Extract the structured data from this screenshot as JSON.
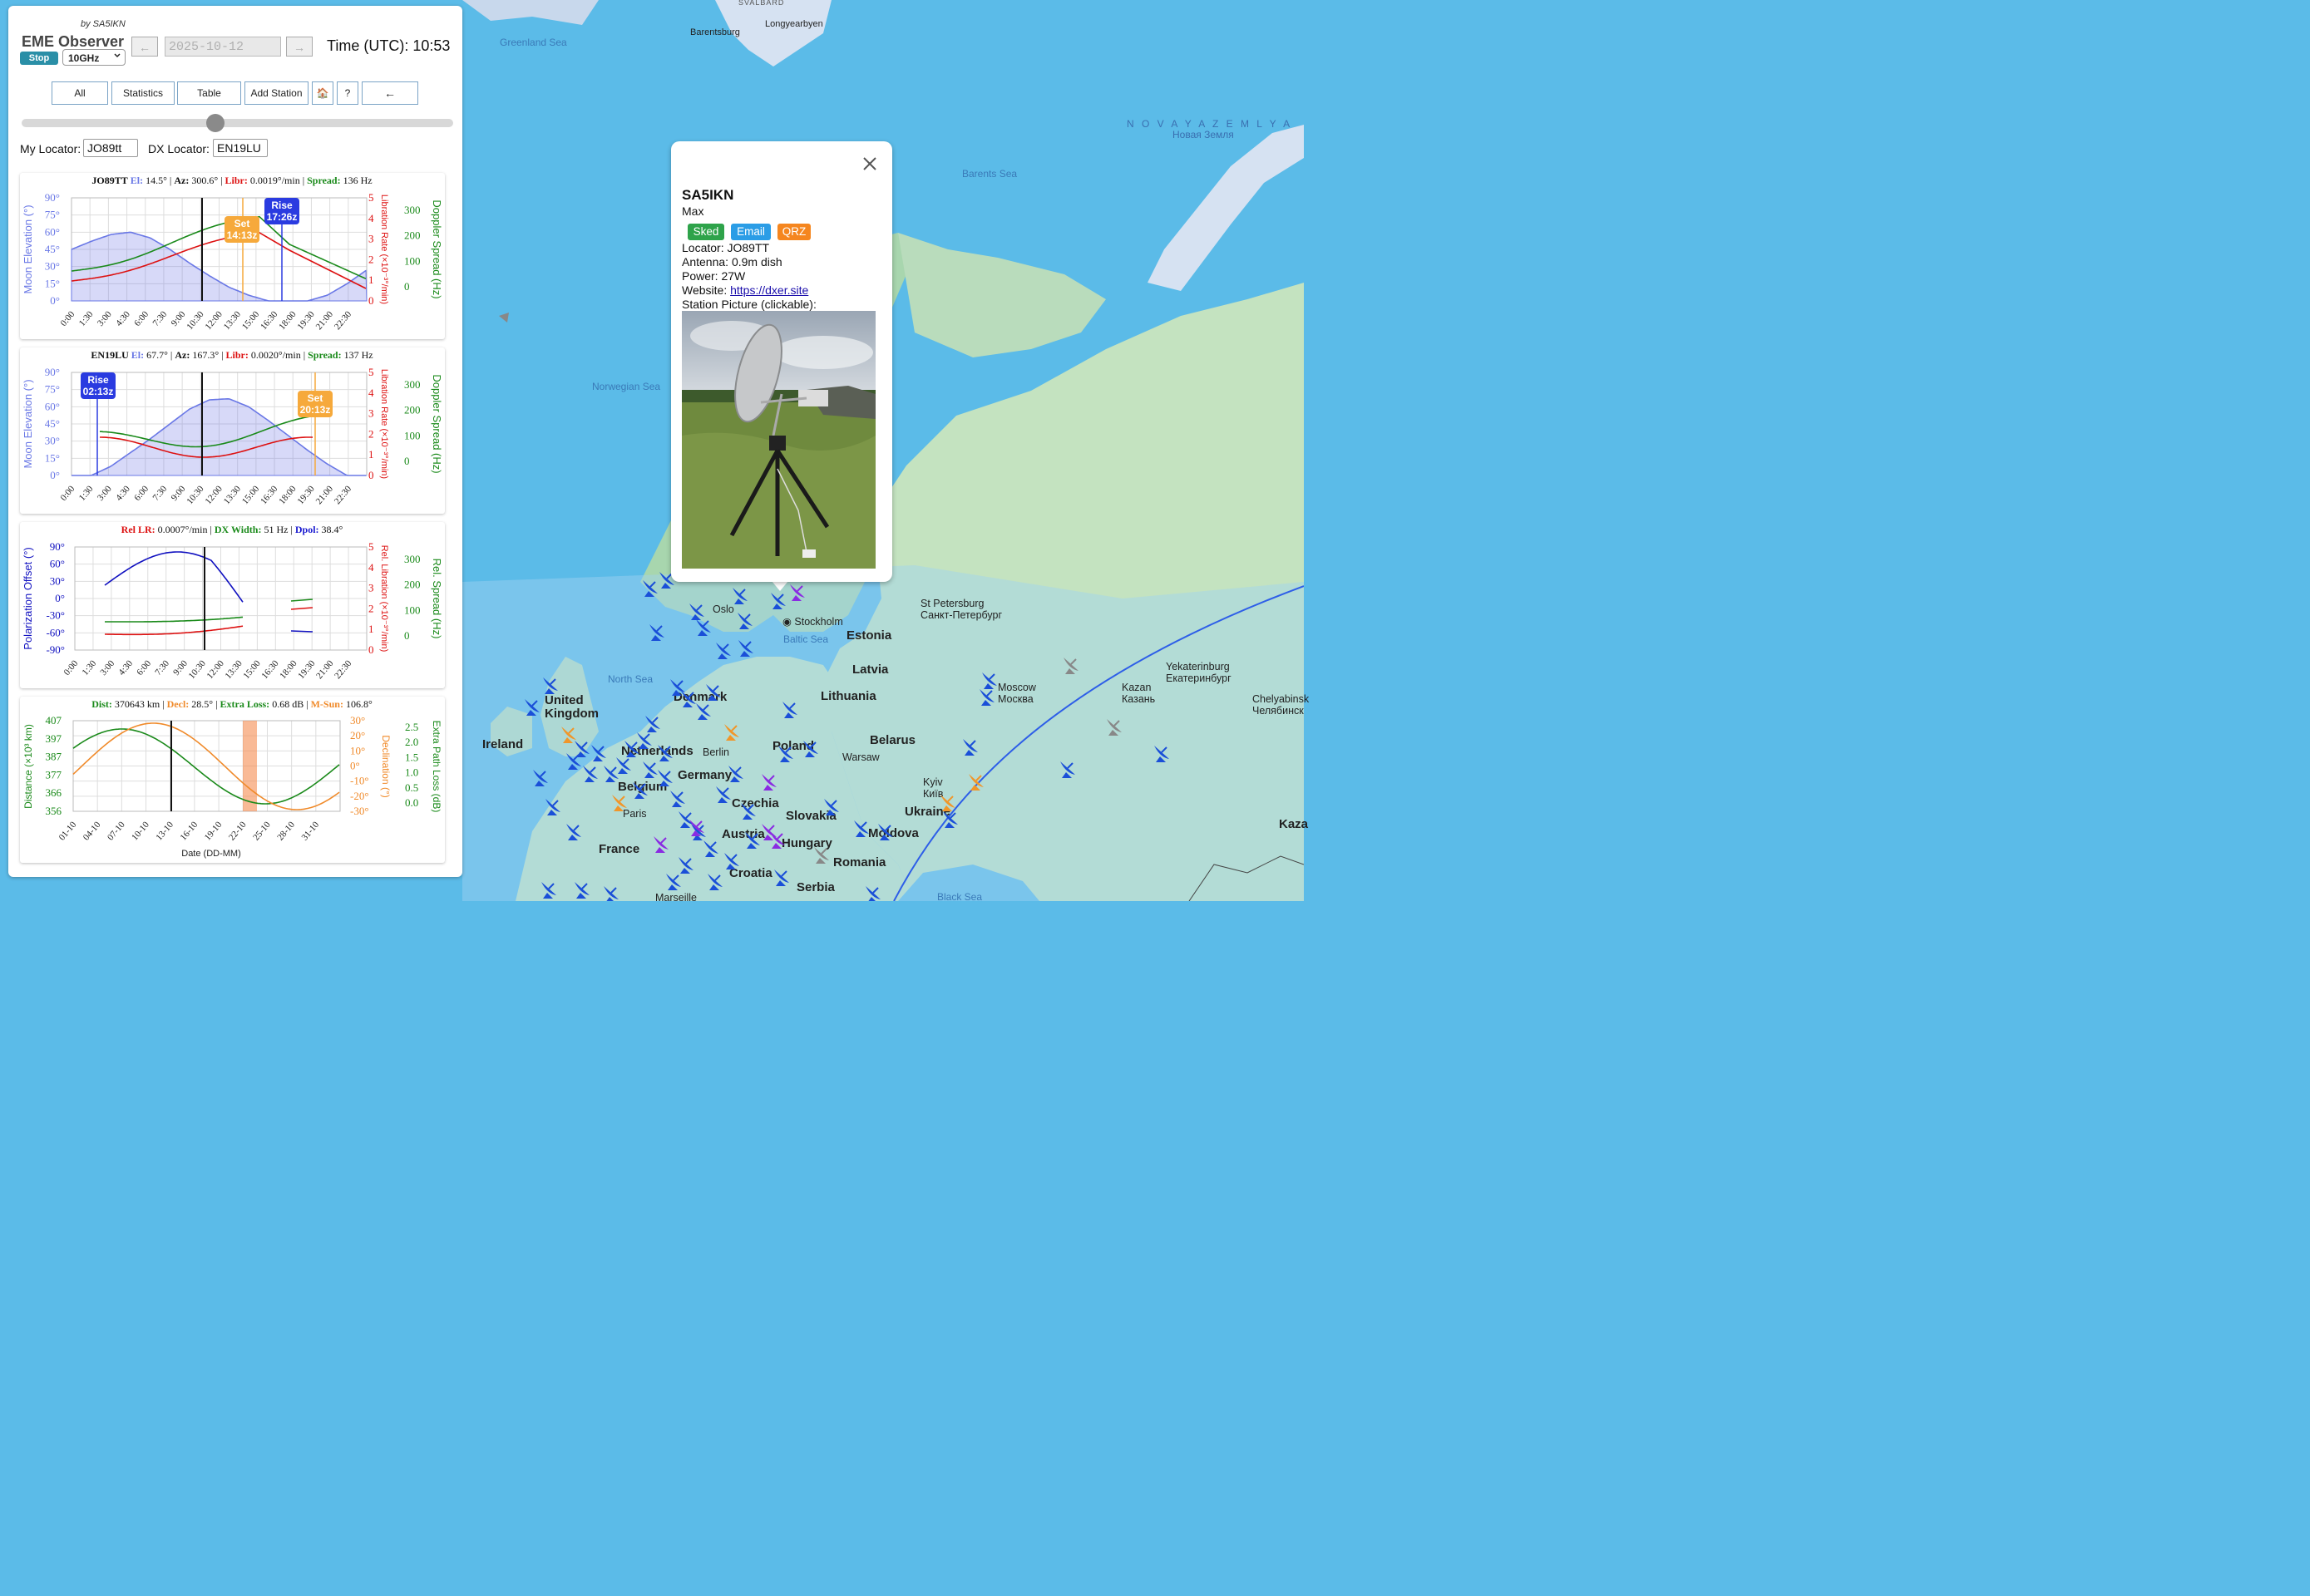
{
  "app": {
    "byline": "by SA5IKN",
    "name": "EME Observer"
  },
  "controls": {
    "stop_label": "Stop",
    "band_value": "10GHz",
    "prev_label": "←",
    "next_label": "→",
    "date_value": "2025-10-12",
    "time_label": "Time (UTC): 10:53"
  },
  "toolbar": {
    "all": "All",
    "statistics": "Statistics",
    "table": "Table",
    "add_station": "Add Station",
    "home": "🏠",
    "help": "?",
    "back": "←"
  },
  "locators": {
    "my_label": "My Locator:",
    "my_value": "JO89tt",
    "dx_label": "DX Locator:",
    "dx_value": "EN19LU"
  },
  "colors": {
    "elevation": "#6a78e6",
    "libration": "#dd1111",
    "spread": "#1a8a1a",
    "set": "#f6a93b",
    "rise": "#2a3be0",
    "now": "#111111",
    "declination": "#f08a2a",
    "station": "#1a4fd8"
  },
  "station_chart_ticks": {
    "time": [
      "0:00",
      "1:30",
      "3:00",
      "4:30",
      "6:00",
      "7:30",
      "9:00",
      "10:30",
      "12:00",
      "13:30",
      "15:00",
      "16:30",
      "18:00",
      "19:30",
      "21:00",
      "22:30"
    ],
    "elev": [
      "90°",
      "75°",
      "60°",
      "45°",
      "30°",
      "15°",
      "0°"
    ],
    "libr": [
      "5",
      "4",
      "3",
      "2",
      "1",
      "0"
    ],
    "spread": [
      "300",
      "200",
      "100",
      "0"
    ]
  },
  "chart1": {
    "station": "JO89TT",
    "el_label": "El:",
    "el": "14.5°",
    "az_label": "Az:",
    "az": "300.6°",
    "libr_label": "Libr:",
    "libr": "0.0019°/min",
    "spread_label": "Spread:",
    "spread": "136 Hz",
    "set_tag": "Set",
    "set_time": "14:13z",
    "rise_tag": "Rise",
    "rise_time": "17:26z",
    "ylabel_left": "Moon Elevation (°)",
    "ylabel_mid": "Libration Rate (×10⁻³°/min)",
    "ylabel_right": "Doppler Spread (Hz)"
  },
  "chart2": {
    "station": "EN19LU",
    "el_label": "El:",
    "el": "67.7°",
    "az_label": "Az:",
    "az": "167.3°",
    "libr_label": "Libr:",
    "libr": "0.0020°/min",
    "spread_label": "Spread:",
    "spread": "137 Hz",
    "rise_tag": "Rise",
    "rise_time": "02:13z",
    "set_tag": "Set",
    "set_time": "20:13z",
    "ylabel_left": "Moon Elevation (°)",
    "ylabel_mid": "Libration Rate (×10⁻³°/min)",
    "ylabel_right": "Doppler Spread (Hz)"
  },
  "chart3": {
    "rel_lr_label": "Rel LR:",
    "rel_lr": "0.0007°/min",
    "dx_width_label": "DX Width:",
    "dx_width": "51 Hz",
    "dpol_label": "Dpol:",
    "dpol": "38.4°",
    "ylabel_left": "Polarization Offset (°)",
    "ylabel_mid": "Rel. Libration (×10⁻³°/min)",
    "ylabel_right": "Rel. Spread (Hz)",
    "left_ticks": [
      "90°",
      "60°",
      "30°",
      "0°",
      "-30°",
      "-60°",
      "-90°"
    ]
  },
  "chart4": {
    "dist_label": "Dist:",
    "dist": "370643 km",
    "decl_label": "Decl:",
    "decl": "28.5°",
    "extra_label": "Extra Loss:",
    "extra": "0.68 dB",
    "msun_label": "M-Sun:",
    "msun": "106.8°",
    "ylabel_left": "Distance (×10³ km)",
    "ylabel_mid": "Declination (°)",
    "ylabel_right": "Extra Path Loss (dB)",
    "xlabel": "Date (DD-MM)",
    "dist_ticks": [
      "407",
      "397",
      "387",
      "377",
      "366",
      "356"
    ],
    "decl_ticks": [
      "30°",
      "20°",
      "10°",
      "0°",
      "-10°",
      "-20°",
      "-30°"
    ],
    "loss_ticks": [
      "2.5",
      "2.0",
      "1.5",
      "1.0",
      "0.5",
      "0.0"
    ],
    "date_ticks": [
      "01-10",
      "04-10",
      "07-10",
      "10-10",
      "13-10",
      "16-10",
      "19-10",
      "22-10",
      "25-10",
      "28-10",
      "31-10"
    ]
  },
  "chart_data": [
    {
      "type": "line",
      "title": "JO89TT",
      "x": [
        "0:00",
        "1:30",
        "3:00",
        "4:30",
        "6:00",
        "7:30",
        "9:00",
        "10:30",
        "12:00",
        "13:30",
        "15:00",
        "16:30",
        "18:00",
        "19:30",
        "21:00",
        "22:30"
      ],
      "series": [
        {
          "name": "Moon Elevation",
          "values": [
            45,
            52,
            58,
            60,
            55,
            45,
            33,
            22,
            12,
            5,
            0,
            0,
            0,
            5,
            15,
            27
          ]
        }
      ],
      "ylim": [
        0,
        90
      ],
      "set": "14:13z",
      "rise": "17:26z"
    },
    {
      "type": "line",
      "title": "EN19LU",
      "x": [
        "0:00",
        "1:30",
        "3:00",
        "4:30",
        "6:00",
        "7:30",
        "9:00",
        "10:30",
        "12:00",
        "13:30",
        "15:00",
        "16:30",
        "18:00",
        "19:30",
        "21:00",
        "22:30"
      ],
      "series": [
        {
          "name": "Moon Elevation",
          "values": [
            0,
            0,
            8,
            20,
            32,
            45,
            58,
            66,
            67,
            60,
            48,
            35,
            22,
            10,
            0,
            0
          ]
        }
      ],
      "ylim": [
        0,
        90
      ],
      "rise": "02:13z",
      "set": "20:13z"
    },
    {
      "type": "line",
      "title": "Polarization / relative libration",
      "x": [
        "0:00",
        "1:30",
        "3:00",
        "4:30",
        "6:00",
        "7:30",
        "9:00",
        "10:30",
        "12:00",
        "13:30",
        "15:00",
        "16:30",
        "18:00",
        "19:30",
        "21:00",
        "22:30"
      ],
      "ylim": [
        -90,
        90
      ]
    },
    {
      "type": "line",
      "title": "Distance / declination / extra loss",
      "x": [
        "01-10",
        "04-10",
        "07-10",
        "10-10",
        "13-10",
        "16-10",
        "19-10",
        "22-10",
        "25-10",
        "28-10",
        "31-10"
      ],
      "xlabel": "Date (DD-MM)"
    }
  ],
  "map": {
    "seas": [
      "Greenland Sea",
      "Barents Sea",
      "Norwegian Sea",
      "North Sea",
      "Baltic Sea",
      "Black Sea"
    ],
    "novaya": "N O V A Y A   Z E M L Y A",
    "novaya_ru": "Новая Земля",
    "svalbard": "SVALBARD",
    "barentsburg": "Barentsburg",
    "longyearbyen": "Longyearbyen",
    "countries": [
      "United Kingdom",
      "Ireland",
      "Denmark",
      "Netherlands",
      "Belgium",
      "Germany",
      "France",
      "Poland",
      "Belarus",
      "Czechia",
      "Slovakia",
      "Austria",
      "Hungary",
      "Romania",
      "Moldova",
      "Ukraine",
      "Croatia",
      "Serbia",
      "Latvia",
      "Lithuania",
      "Estonia",
      "Kaza"
    ],
    "cities": [
      "Oslo",
      "Stockholm",
      "Berlin",
      "Warsaw",
      "Paris",
      "Kyiv\nКиїв",
      "Moscow\nМосква",
      "St Petersburg\nСанкт-Петербург",
      "Kazan\nКазань",
      "Yekaterinburg\nЕкатеринбург",
      "Chelyabinsk\nЧелябинск",
      "Marseille"
    ]
  },
  "popup": {
    "callsign": "SA5IKN",
    "name": "Max",
    "sked": "Sked",
    "email": "Email",
    "qrz": "QRZ",
    "locator": "Locator: JO89TT",
    "antenna": "Antenna: 0.9m dish",
    "power": "Power: 27W",
    "website_label": "Website:",
    "website_url": "https://dxer.site",
    "picture_label": "Station Picture (clickable):"
  }
}
